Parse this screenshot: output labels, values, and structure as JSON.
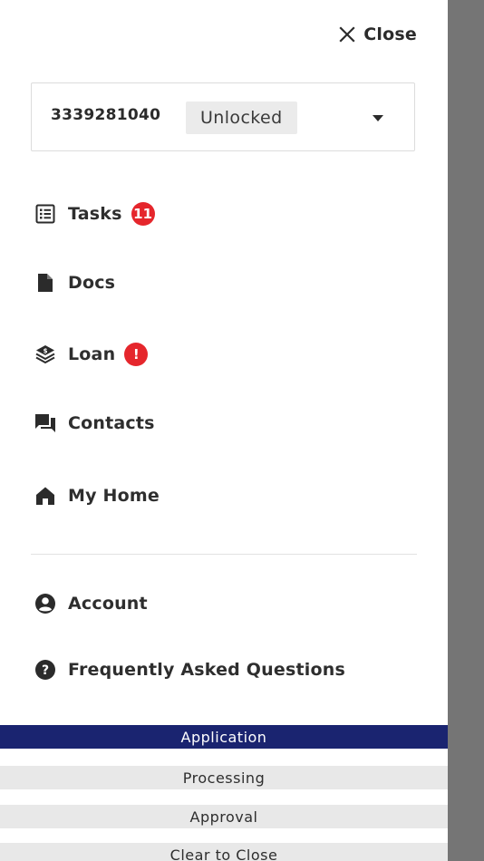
{
  "header": {
    "close_label": "Close"
  },
  "loan_selector": {
    "loan_number": "3339281040",
    "status": "Unlocked"
  },
  "nav": {
    "items": [
      {
        "label": "Tasks",
        "icon": "list-icon",
        "badge": "11"
      },
      {
        "label": "Docs",
        "icon": "document-icon"
      },
      {
        "label": "Loan",
        "icon": "layers-dollar-icon",
        "badge": "!"
      },
      {
        "label": "Contacts",
        "icon": "chat-icon"
      },
      {
        "label": "My Home",
        "icon": "home-icon"
      }
    ],
    "secondary": [
      {
        "label": "Account",
        "icon": "account-circle-icon"
      },
      {
        "label": "Frequently Asked Questions",
        "icon": "help-circle-icon"
      }
    ]
  },
  "stages": [
    {
      "label": "Application",
      "active": true
    },
    {
      "label": "Processing",
      "active": false
    },
    {
      "label": "Approval",
      "active": false
    },
    {
      "label": "Clear to Close",
      "active": false
    }
  ],
  "colors": {
    "badge": "#e5262c",
    "active_stage": "#1a2470",
    "inactive_stage": "#e8e8e8",
    "scrim": "#757575"
  }
}
